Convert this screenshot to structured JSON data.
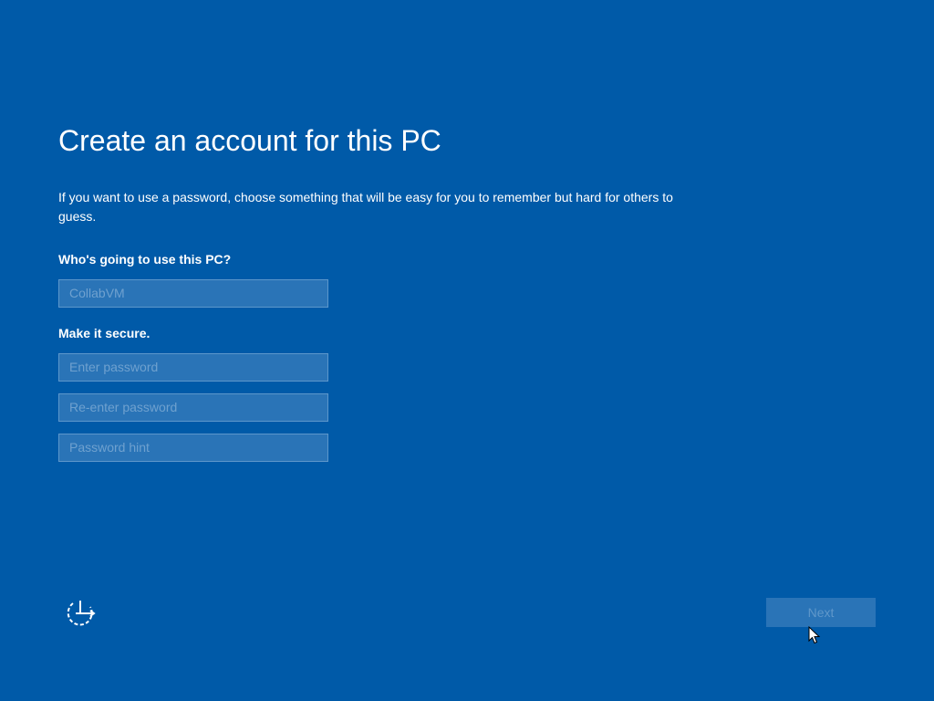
{
  "page": {
    "title": "Create an account for this PC",
    "description": "If you want to use a password, choose something that will be easy for you to remember but hard for others to guess."
  },
  "user_section": {
    "label": "Who's going to use this PC?",
    "username_value": "CollabVM"
  },
  "secure_section": {
    "label": "Make it secure.",
    "password_placeholder": "Enter password",
    "reenter_placeholder": "Re-enter password",
    "hint_placeholder": "Password hint"
  },
  "footer": {
    "ease_of_access_icon": "ease-of-access-icon",
    "next_label": "Next"
  },
  "colors": {
    "background": "#005aa8",
    "field_background": "#2a74b7",
    "field_border": "#5d97cb",
    "placeholder_text": "#6fa1cf",
    "button_text_disabled": "#5f97ca"
  }
}
